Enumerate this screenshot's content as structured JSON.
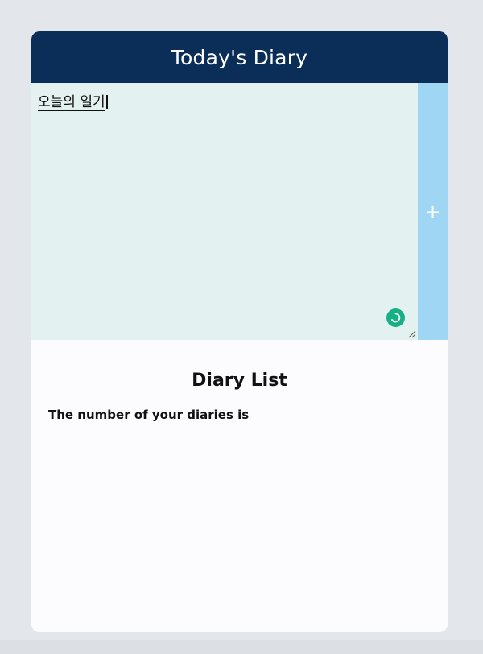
{
  "header": {
    "title": "Today's Diary"
  },
  "editor": {
    "value": "오늘의 일기",
    "grammar_icon": "spinner-icon",
    "add_label": "+",
    "add_icon": "plus-icon"
  },
  "list": {
    "title": "Diary List",
    "count_text": "The number of your diaries is"
  },
  "colors": {
    "header_bg": "#0b2e58",
    "editor_bg": "#e3f2f0",
    "add_button_bg": "#9fd6f3",
    "badge": "#16b086",
    "page_bg": "#e3e6ea",
    "card_bg": "#fcfbfe"
  }
}
